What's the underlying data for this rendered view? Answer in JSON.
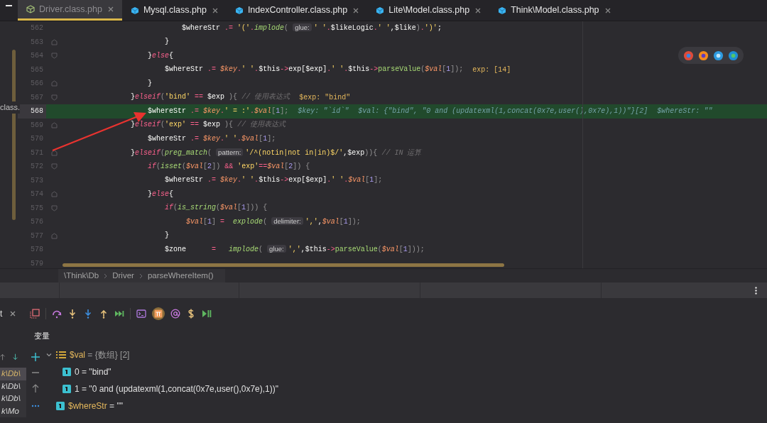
{
  "tabs": [
    {
      "label": "Driver.class.php",
      "selected": true,
      "kind": "outline"
    },
    {
      "label": "Mysql.class.php",
      "selected": false,
      "kind": "filled"
    },
    {
      "label": "IndexController.class.php",
      "selected": false,
      "kind": "filled"
    },
    {
      "label": "Lite\\Model.class.php",
      "selected": false,
      "kind": "filled"
    },
    {
      "label": "Think\\Model.class.php",
      "selected": false,
      "kind": "filled"
    }
  ],
  "side_panel_text": "class.",
  "editor": {
    "lines": [
      {
        "number": "562",
        "current": false,
        "code": [
          {
            "kind": "plain",
            "text": "                            $whereStr "
          },
          {
            "kind": "op",
            "text": ".= "
          },
          {
            "kind": "str",
            "text": "'('"
          },
          {
            "kind": "op",
            "text": "."
          },
          {
            "kind": "fn",
            "text": "implode"
          },
          {
            "kind": "paren",
            "text": "( "
          },
          {
            "kind": "hint",
            "text": "glue:"
          },
          {
            "kind": "str",
            "text": "' '"
          },
          {
            "kind": "op",
            "text": "."
          },
          {
            "kind": "plain",
            "text": "$likeLogic"
          },
          {
            "kind": "op",
            "text": "."
          },
          {
            "kind": "str",
            "text": "' '"
          },
          {
            "kind": "plain",
            "text": ",$like"
          },
          {
            "kind": "paren",
            "text": ")"
          },
          {
            "kind": "op",
            "text": "."
          },
          {
            "kind": "str",
            "text": "')'"
          },
          {
            "kind": "plain",
            "text": ";"
          }
        ]
      },
      {
        "number": "563",
        "current": false,
        "fold_end": true,
        "code": [
          {
            "kind": "plain",
            "text": "                        }"
          }
        ]
      },
      {
        "number": "564",
        "current": false,
        "fold_start": true,
        "code": [
          {
            "kind": "plain",
            "text": "                    }"
          },
          {
            "kind": "kw",
            "text": "else"
          },
          {
            "kind": "plain",
            "text": "{"
          }
        ]
      },
      {
        "number": "565",
        "current": false,
        "code": [
          {
            "kind": "plain",
            "text": "                        $whereStr "
          },
          {
            "kind": "op",
            "text": ".= "
          },
          {
            "kind": "var",
            "text": "$key"
          },
          {
            "kind": "op",
            "text": "."
          },
          {
            "kind": "str",
            "text": "' '"
          },
          {
            "kind": "op",
            "text": "."
          },
          {
            "kind": "plain",
            "text": "$this"
          },
          {
            "kind": "op",
            "text": "->"
          },
          {
            "kind": "plain",
            "text": "exp[$exp]"
          },
          {
            "kind": "op",
            "text": "."
          },
          {
            "kind": "str",
            "text": "' '"
          },
          {
            "kind": "op",
            "text": "."
          },
          {
            "kind": "plain",
            "text": "$this"
          },
          {
            "kind": "op",
            "text": "->"
          },
          {
            "kind": "fn2",
            "text": "parseValue"
          },
          {
            "kind": "paren",
            "text": "("
          },
          {
            "kind": "var",
            "text": "$val"
          },
          {
            "kind": "paren",
            "text": "["
          },
          {
            "kind": "num",
            "text": "1"
          },
          {
            "kind": "paren",
            "text": "]);"
          }
        ],
        "debug": [
          "exp: [14]"
        ]
      },
      {
        "number": "566",
        "current": false,
        "fold_end": true,
        "code": [
          {
            "kind": "plain",
            "text": "                    }"
          }
        ]
      },
      {
        "number": "567",
        "current": false,
        "fold_start": true,
        "code": [
          {
            "kind": "plain",
            "text": "                }"
          },
          {
            "kind": "kw",
            "text": "elseif"
          },
          {
            "kind": "paren",
            "text": "("
          },
          {
            "kind": "str",
            "text": "'bind'"
          },
          {
            "kind": "op",
            "text": " == "
          },
          {
            "kind": "plain",
            "text": "$exp "
          },
          {
            "kind": "paren",
            "text": "){"
          },
          {
            "kind": "cm",
            "text": " // 使用表达式"
          }
        ],
        "debug": [
          "$exp: \"bind\""
        ]
      },
      {
        "number": "568",
        "current": true,
        "code": [
          {
            "kind": "plain",
            "text": "                    $whereStr "
          },
          {
            "kind": "op",
            "text": ".= "
          },
          {
            "kind": "var",
            "text": "$key"
          },
          {
            "kind": "op",
            "text": "."
          },
          {
            "kind": "str",
            "text": "' = :'"
          },
          {
            "kind": "op",
            "text": "."
          },
          {
            "kind": "var",
            "text": "$val"
          },
          {
            "kind": "paren",
            "text": "["
          },
          {
            "kind": "num",
            "text": "1"
          },
          {
            "kind": "paren",
            "text": "];"
          }
        ],
        "debug": [
          "$key: \"`id`\"",
          "$val: {\"bind\", \"0 and (updatexml(1,concat(0x7e,user(),0x7e),1))\"}[2]",
          "$whereStr: \"\""
        ]
      },
      {
        "number": "569",
        "current": false,
        "fold_end": true,
        "code": [
          {
            "kind": "plain",
            "text": "                }"
          },
          {
            "kind": "kw",
            "text": "elseif"
          },
          {
            "kind": "paren",
            "text": "("
          },
          {
            "kind": "str",
            "text": "'exp'"
          },
          {
            "kind": "op",
            "text": " == "
          },
          {
            "kind": "plain",
            "text": "$exp "
          },
          {
            "kind": "paren",
            "text": "){"
          },
          {
            "kind": "cm",
            "text": " // 使用表达式"
          }
        ]
      },
      {
        "number": "570",
        "current": false,
        "code": [
          {
            "kind": "plain",
            "text": "                    $whereStr "
          },
          {
            "kind": "op",
            "text": ".= "
          },
          {
            "kind": "var",
            "text": "$key"
          },
          {
            "kind": "op",
            "text": "."
          },
          {
            "kind": "str",
            "text": "' '"
          },
          {
            "kind": "op",
            "text": "."
          },
          {
            "kind": "var",
            "text": "$val"
          },
          {
            "kind": "paren",
            "text": "["
          },
          {
            "kind": "num",
            "text": "1"
          },
          {
            "kind": "paren",
            "text": "];"
          }
        ]
      },
      {
        "number": "571",
        "current": false,
        "fold_end": true,
        "code": [
          {
            "kind": "plain",
            "text": "                }"
          },
          {
            "kind": "kw",
            "text": "elseif"
          },
          {
            "kind": "paren",
            "text": "("
          },
          {
            "kind": "fn",
            "text": "preg_match"
          },
          {
            "kind": "paren",
            "text": "( "
          },
          {
            "kind": "hint",
            "text": "pattern:"
          },
          {
            "kind": "str",
            "text": "'/^(notin|not in|in)$/'"
          },
          {
            "kind": "plain",
            "text": ",$exp"
          },
          {
            "kind": "paren",
            "text": ")){"
          },
          {
            "kind": "cm",
            "text": " // IN 运算"
          }
        ]
      },
      {
        "number": "572",
        "current": false,
        "fold_start": true,
        "code": [
          {
            "kind": "kw",
            "text": "                    if"
          },
          {
            "kind": "paren",
            "text": "("
          },
          {
            "kind": "fn",
            "text": "isset"
          },
          {
            "kind": "paren",
            "text": "("
          },
          {
            "kind": "var",
            "text": "$val"
          },
          {
            "kind": "paren",
            "text": "["
          },
          {
            "kind": "num",
            "text": "2"
          },
          {
            "kind": "paren",
            "text": "])"
          },
          {
            "kind": "op",
            "text": " && "
          },
          {
            "kind": "str",
            "text": "'exp'"
          },
          {
            "kind": "op",
            "text": "=="
          },
          {
            "kind": "var",
            "text": "$val"
          },
          {
            "kind": "paren",
            "text": "["
          },
          {
            "kind": "num",
            "text": "2"
          },
          {
            "kind": "paren",
            "text": "]) {"
          }
        ]
      },
      {
        "number": "573",
        "current": false,
        "code": [
          {
            "kind": "plain",
            "text": "                        $whereStr "
          },
          {
            "kind": "op",
            "text": ".= "
          },
          {
            "kind": "var",
            "text": "$key"
          },
          {
            "kind": "op",
            "text": "."
          },
          {
            "kind": "str",
            "text": "' '"
          },
          {
            "kind": "op",
            "text": "."
          },
          {
            "kind": "plain",
            "text": "$this"
          },
          {
            "kind": "op",
            "text": "->"
          },
          {
            "kind": "plain",
            "text": "exp[$exp]"
          },
          {
            "kind": "op",
            "text": "."
          },
          {
            "kind": "str",
            "text": "' '"
          },
          {
            "kind": "op",
            "text": "."
          },
          {
            "kind": "var",
            "text": "$val"
          },
          {
            "kind": "paren",
            "text": "["
          },
          {
            "kind": "num",
            "text": "1"
          },
          {
            "kind": "paren",
            "text": "];"
          }
        ]
      },
      {
        "number": "574",
        "current": false,
        "fold_end": true,
        "code": [
          {
            "kind": "plain",
            "text": "                    }"
          },
          {
            "kind": "kw",
            "text": "else"
          },
          {
            "kind": "plain",
            "text": "{"
          }
        ]
      },
      {
        "number": "575",
        "current": false,
        "fold_start": true,
        "code": [
          {
            "kind": "kw",
            "text": "                        if"
          },
          {
            "kind": "paren",
            "text": "("
          },
          {
            "kind": "fn",
            "text": "is_string"
          },
          {
            "kind": "paren",
            "text": "("
          },
          {
            "kind": "var",
            "text": "$val"
          },
          {
            "kind": "paren",
            "text": "["
          },
          {
            "kind": "num",
            "text": "1"
          },
          {
            "kind": "paren",
            "text": "])) {"
          }
        ]
      },
      {
        "number": "576",
        "current": false,
        "code": [
          {
            "kind": "var",
            "text": "                             $val"
          },
          {
            "kind": "paren",
            "text": "["
          },
          {
            "kind": "num",
            "text": "1"
          },
          {
            "kind": "paren",
            "text": "]"
          },
          {
            "kind": "op",
            "text": " =  "
          },
          {
            "kind": "fn",
            "text": "explode"
          },
          {
            "kind": "paren",
            "text": "( "
          },
          {
            "kind": "hint",
            "text": "delimiter:"
          },
          {
            "kind": "str",
            "text": "','"
          },
          {
            "kind": "plain",
            "text": ","
          },
          {
            "kind": "var",
            "text": "$val"
          },
          {
            "kind": "paren",
            "text": "["
          },
          {
            "kind": "num",
            "text": "1"
          },
          {
            "kind": "paren",
            "text": "]);"
          }
        ]
      },
      {
        "number": "577",
        "current": false,
        "fold_end": true,
        "code": [
          {
            "kind": "plain",
            "text": "                        }"
          }
        ]
      },
      {
        "number": "578",
        "current": false,
        "code": [
          {
            "kind": "plain",
            "text": "                        $zone      "
          },
          {
            "kind": "op",
            "text": "=   "
          },
          {
            "kind": "fn",
            "text": "implode"
          },
          {
            "kind": "paren",
            "text": "( "
          },
          {
            "kind": "hint",
            "text": "glue:"
          },
          {
            "kind": "str",
            "text": "','"
          },
          {
            "kind": "plain",
            "text": ",$this"
          },
          {
            "kind": "op",
            "text": "->"
          },
          {
            "kind": "fn2",
            "text": "parseValue"
          },
          {
            "kind": "paren",
            "text": "("
          },
          {
            "kind": "var",
            "text": "$val"
          },
          {
            "kind": "paren",
            "text": "["
          },
          {
            "kind": "num",
            "text": "1"
          },
          {
            "kind": "paren",
            "text": "]));"
          }
        ]
      },
      {
        "number": "579",
        "current": false
      }
    ]
  },
  "breadcrumb": [
    "\\Think\\Db",
    "Driver",
    "parseWhereItem()"
  ],
  "debug_panel": {
    "tab_label": "t",
    "variables_title": "变量",
    "frames": [
      {
        "label": "k\\Db\\",
        "selected": true
      },
      {
        "label": "k\\Db\\",
        "selected": false
      },
      {
        "label": "k\\Db\\",
        "selected": false
      },
      {
        "label": "k\\Mo",
        "selected": false
      }
    ],
    "variables": [
      {
        "name": "$val",
        "value": "= {数组} [2]",
        "kind": "array",
        "expanded": true,
        "children": [
          {
            "name": "0",
            "value": "= \"bind\"",
            "kind": "scalar"
          },
          {
            "name": "1",
            "value": "= \"0 and (updatexml(1,concat(0x7e,user(),0x7e),1))\"",
            "kind": "scalar"
          }
        ]
      },
      {
        "name": "$whereStr",
        "value": "= \"\"",
        "kind": "scalar"
      }
    ]
  }
}
